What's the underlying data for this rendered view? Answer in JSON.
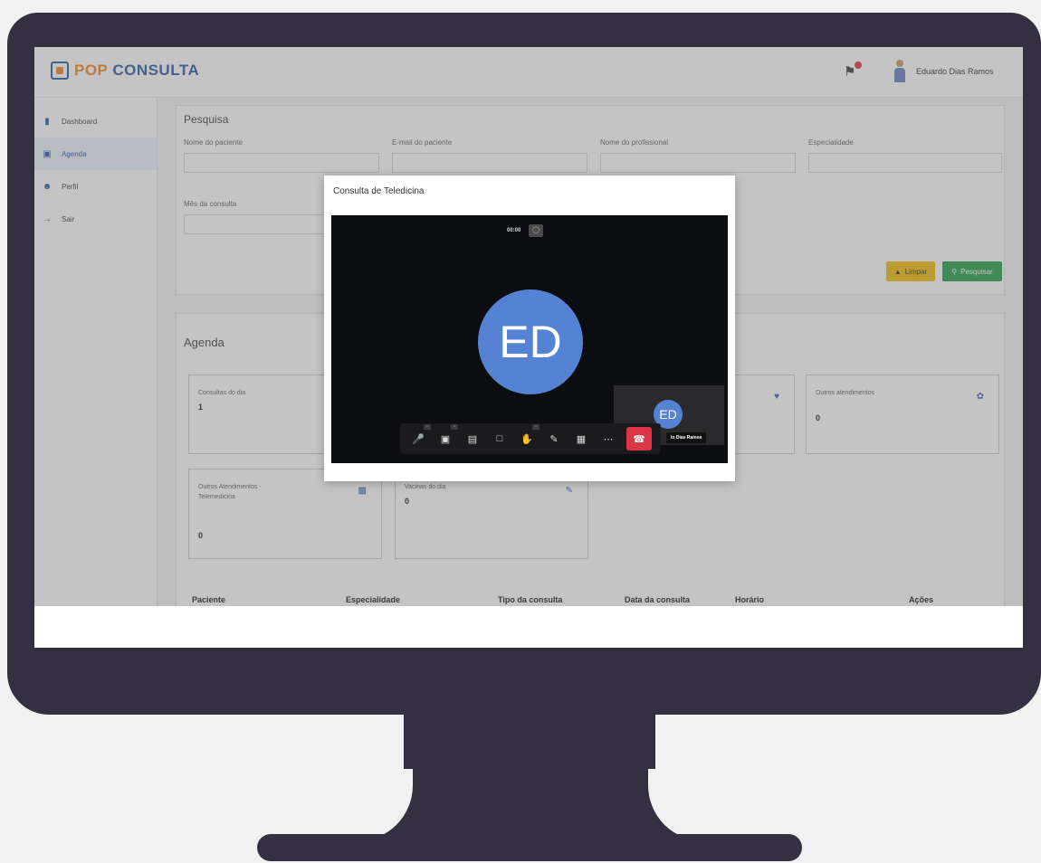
{
  "header": {
    "logo_brand": "POP CONSULTA",
    "user_name": "Eduardo Dias Ramos"
  },
  "sidebar": {
    "items": [
      {
        "label": "Dashboard",
        "icon": "bar-chart-icon"
      },
      {
        "label": "Agenda",
        "icon": "calendar-icon"
      },
      {
        "label": "Perfil",
        "icon": "user-icon"
      },
      {
        "label": "Sair",
        "icon": "logout-icon"
      }
    ]
  },
  "search": {
    "title": "Pesquisa",
    "fields": [
      {
        "label": "Nome do paciente",
        "value": ""
      },
      {
        "label": "E-mail do paciente",
        "value": ""
      },
      {
        "label": "Nome do profissional",
        "value": ""
      },
      {
        "label": "Especialidade",
        "value": ""
      },
      {
        "label": "Mês da consulta",
        "value": ""
      }
    ],
    "clear_label": "Limpar",
    "search_label": "Pesquisar"
  },
  "agenda": {
    "title": "Agenda",
    "stats": [
      {
        "title": "Consultas do dia",
        "value": "1"
      },
      {
        "title": "Outros atendimentos",
        "value": "0"
      },
      {
        "title": "Outros Atendimentos - Telemedicina",
        "value": "0"
      },
      {
        "title": "Vacinas do dia",
        "value": "0"
      }
    ],
    "table_headers": [
      "Paciente",
      "Especialidade",
      "Tipo da consulta",
      "Data da consulta",
      "Horário",
      "Ações"
    ]
  },
  "modal": {
    "title": "Consulta de Teledicina",
    "timer": "00:00",
    "main_initials": "ED",
    "tile_initials": "ED",
    "tile_name": "lo Dias Ramos"
  },
  "colors": {
    "monitor": "#343041",
    "primary": "#2f5fa8",
    "accent": "#f08a24",
    "avatar": "#5682d3",
    "end_call": "#dc3545",
    "btn_yellow": "#f3bf12",
    "btn_green": "#2ea44f"
  }
}
